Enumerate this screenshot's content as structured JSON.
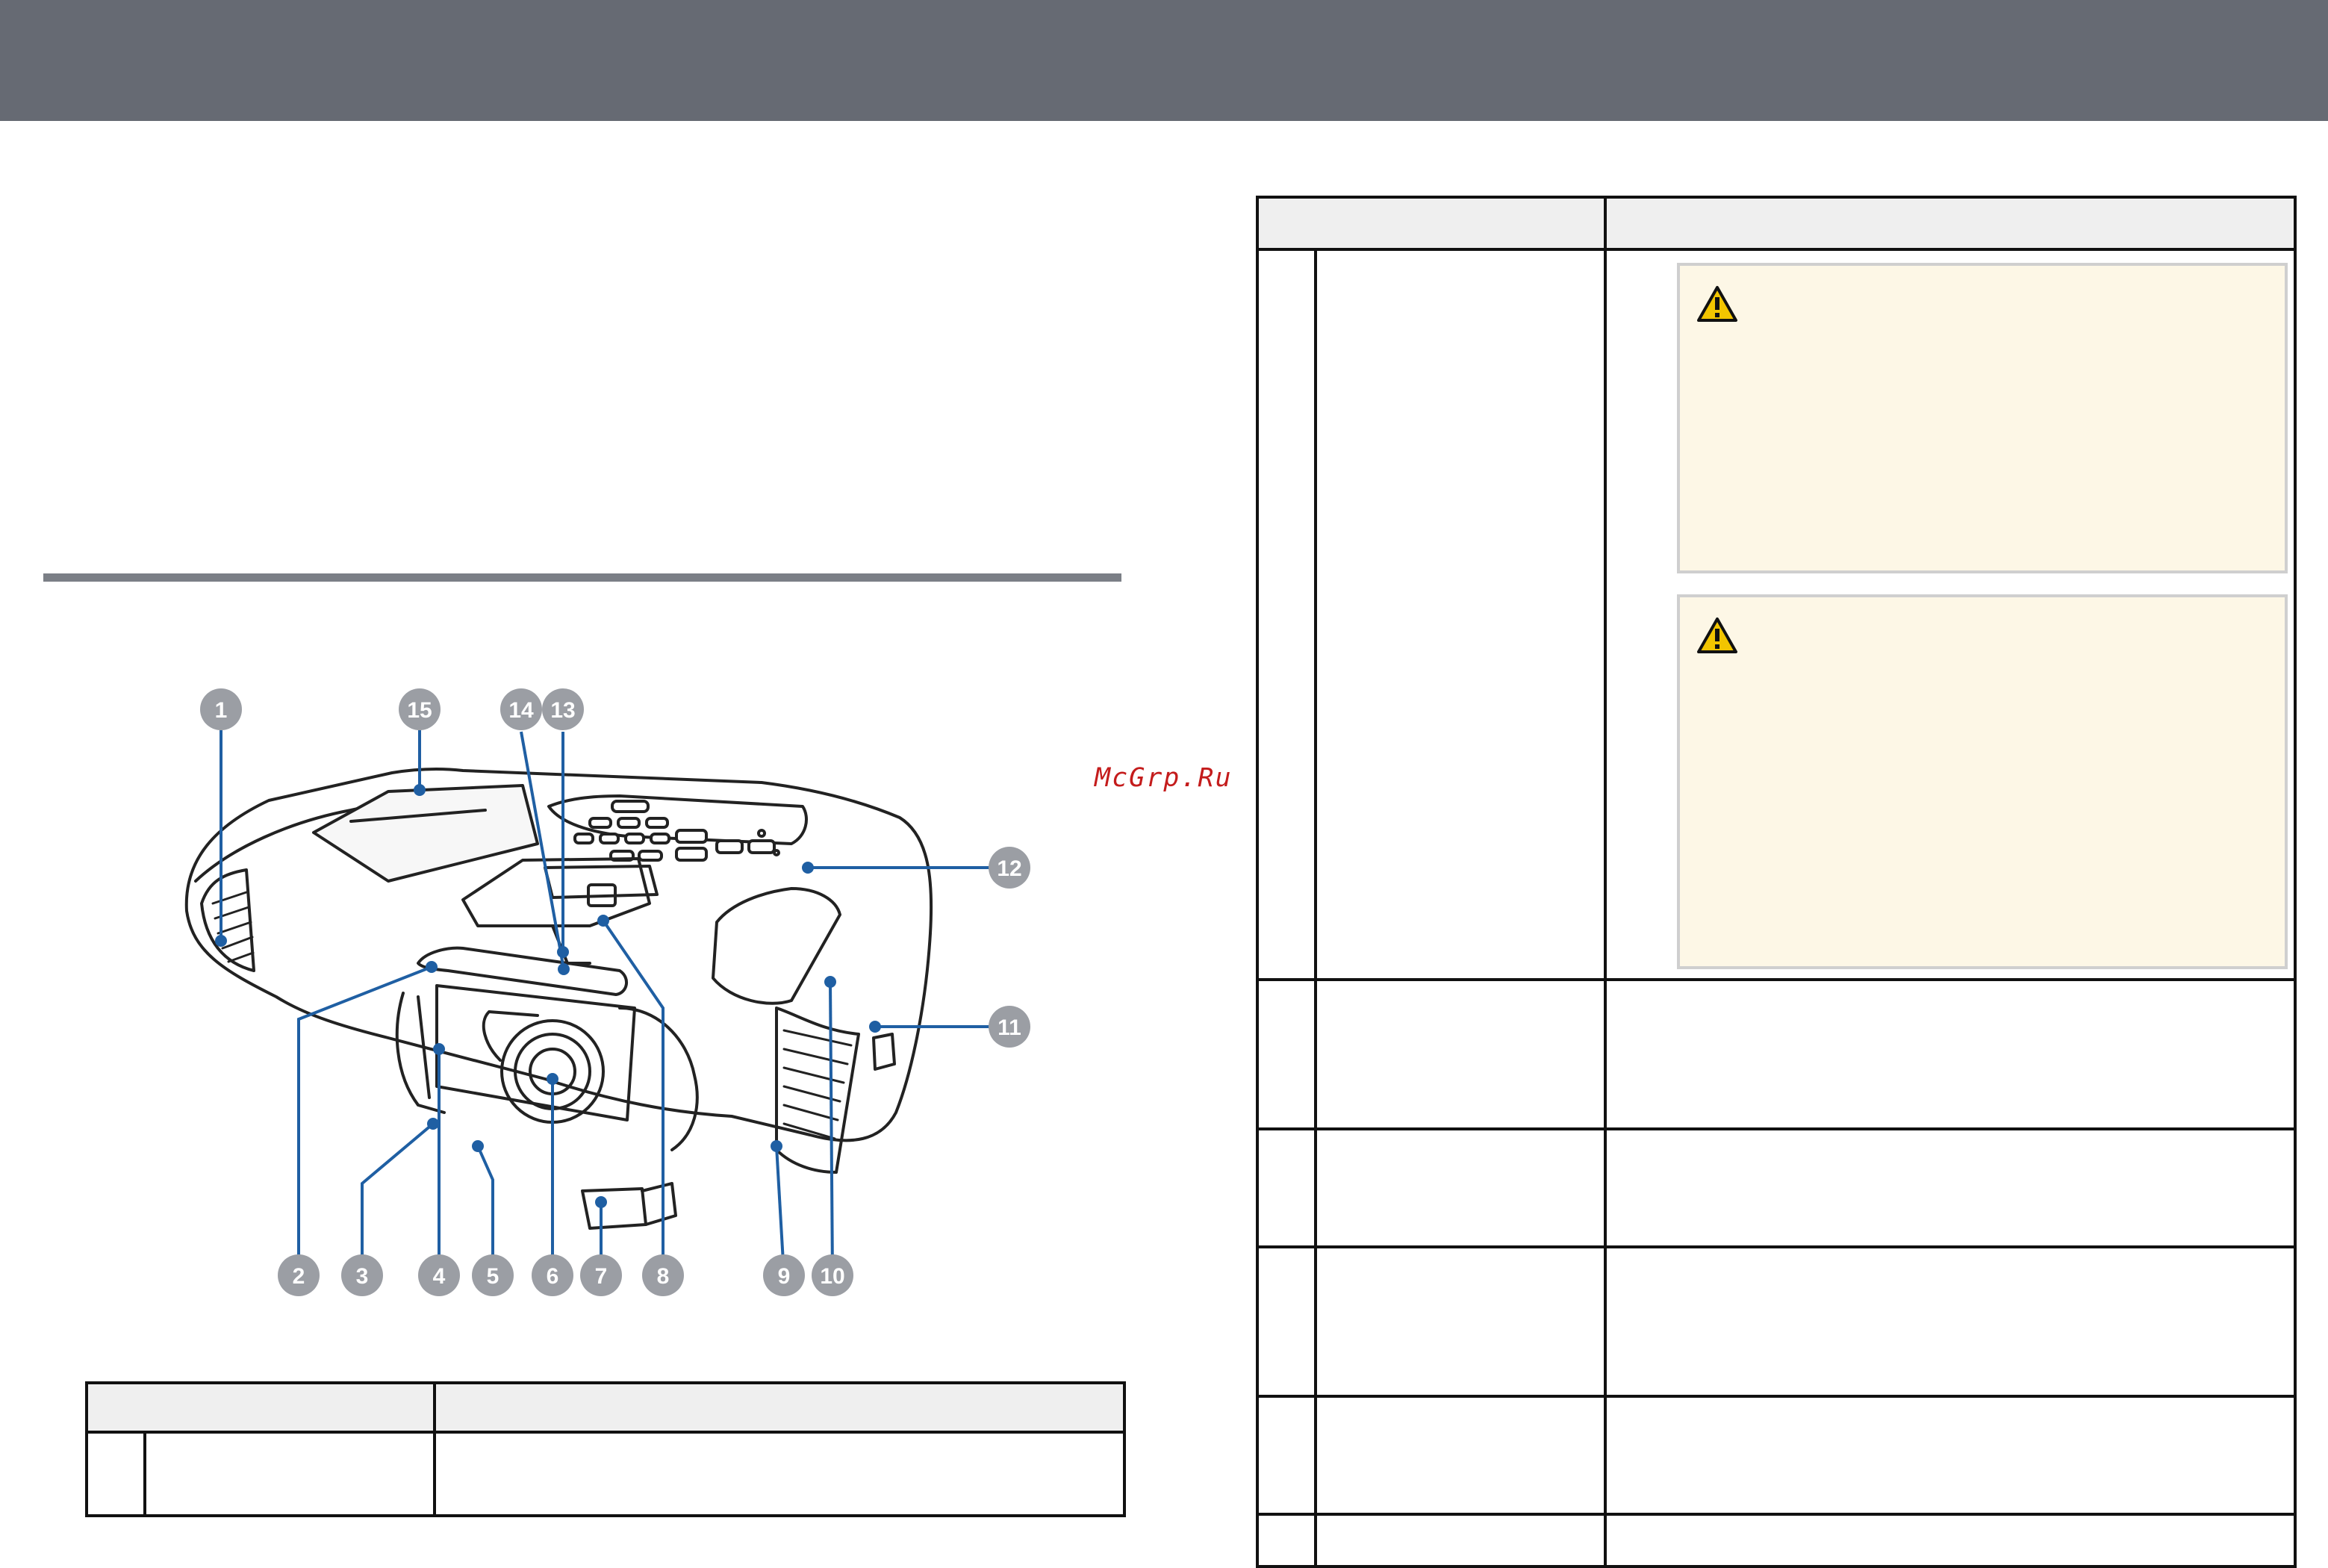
{
  "watermark": {
    "text": "McGrp.Ru"
  },
  "callouts": [
    "1",
    "2",
    "3",
    "4",
    "5",
    "6",
    "7",
    "8",
    "9",
    "10",
    "11",
    "12",
    "13",
    "14",
    "15"
  ],
  "icons": {
    "warning": "warning-triangle-icon"
  },
  "colors": {
    "header_bar": "#666a73",
    "callout": "#9b9ea4",
    "leader": "#1f5fa3",
    "warning_fill": "#fdf7e6",
    "warning_icon": "#f2c500"
  }
}
